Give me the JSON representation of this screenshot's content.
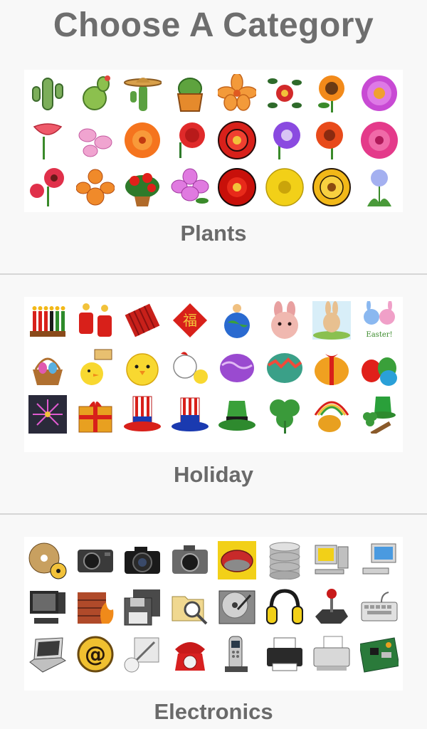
{
  "header": {
    "title": "Choose A Category"
  },
  "categories": [
    {
      "label": "Plants",
      "icons": [
        "cactus-icon",
        "prickly-pear-icon",
        "sombrero-cactus-icon",
        "potted-cactus-icon",
        "lily-icon",
        "rose-vine-icon",
        "sunflower-icon",
        "purple-daisy-icon",
        "trumpet-flower-icon",
        "pink-orchid-icon",
        "orange-poppy-icon",
        "red-carnation-icon",
        "tudor-rose-icon",
        "morning-glory-icon",
        "red-gerbera-icon",
        "pink-gerbera-icon",
        "red-daisies-icon",
        "orange-orchid-icon",
        "potted-geranium-icon",
        "azalea-icon",
        "red-rose-icon",
        "yellow-poppy-icon",
        "yellow-zinnia-icon",
        "agapanthus-icon"
      ]
    },
    {
      "label": "Holiday",
      "icons": [
        "kwanzaa-candles-icon",
        "firecrackers-icon",
        "red-firecrackers-icon",
        "fortune-sign-icon",
        "earth-day-icon",
        "bunny-face-icon",
        "easter-bunny-icon",
        "easter-bunnies-icon",
        "egg-basket-icon",
        "chick-with-sign-icon",
        "yellow-chick-icon",
        "hen-chick-icon",
        "purple-egg-icon",
        "green-egg-icon",
        "gift-egg-icon",
        "colored-eggs-icon",
        "fireworks-icon",
        "gift-box-icon",
        "uncle-sam-hat-icon",
        "patriot-hat-icon",
        "leprechaun-hat-icon",
        "shamrock-icon",
        "pot-of-gold-icon",
        "shamrock-hat-icon"
      ]
    },
    {
      "label": "Electronics",
      "icons": [
        "radiation-disc-icon",
        "digital-camera-icon",
        "dslr-camera-icon",
        "compact-camera-icon",
        "computer-mouse-icon",
        "database-icon",
        "desktop-computer-icon",
        "monitor-workstation-icon",
        "crt-computer-icon",
        "firewall-icon",
        "floppy-disk-icon",
        "folder-search-icon",
        "hard-drive-icon",
        "headphones-icon",
        "joystick-icon",
        "keyboard-icon",
        "laptop-icon",
        "email-at-icon",
        "drawing-tablet-icon",
        "red-telephone-icon",
        "cordless-phone-icon",
        "printer-icon",
        "scanner-icon",
        "circuit-board-icon"
      ]
    }
  ]
}
